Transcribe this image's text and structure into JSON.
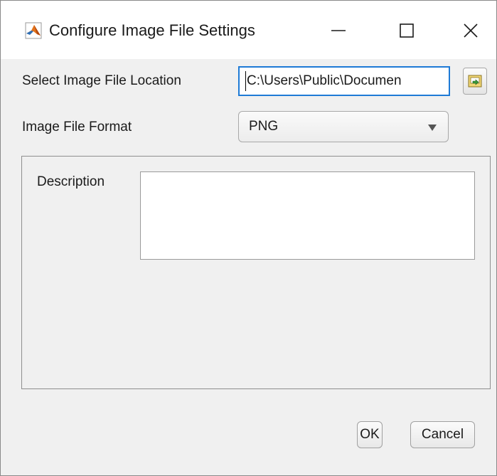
{
  "window": {
    "title": "Configure Image File Settings"
  },
  "form": {
    "location_label": "Select Image File Location",
    "location_value": "C:\\Users\\Public\\Documen",
    "format_label": "Image File Format",
    "format_selected": "PNG",
    "description_label": "Description",
    "description_value": ""
  },
  "buttons": {
    "ok_label": "OK",
    "cancel_label": "Cancel"
  },
  "icons": {
    "app": "matlab-icon",
    "browse": "folder-browse-icon"
  },
  "colors": {
    "focus_border": "#1e7ad6",
    "dialog_background": "#f0f0f0"
  }
}
